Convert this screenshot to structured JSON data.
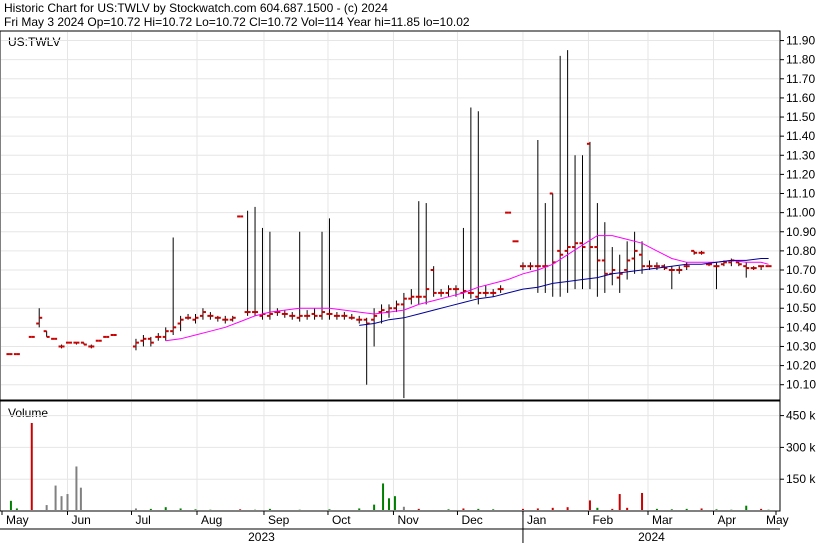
{
  "header": {
    "line1": "Historic Chart for US:TWLV by Stockwatch.com 604.687.1500 - (c) 2024",
    "line2": "Fri May  3 2024  Op=10.72  Hi=10.72  Lo=10.72  Cl=10.72  Vol=114  Year hi=11.85  lo=10.02"
  },
  "chart_data": {
    "type": "ohlc",
    "symbol_label": "US:TWLV",
    "volume_label": "Volume",
    "price_axis_ticks": [
      "11.90",
      "11.80",
      "11.70",
      "11.60",
      "11.50",
      "11.40",
      "11.30",
      "11.20",
      "11.10",
      "11.00",
      "10.90",
      "10.80",
      "10.70",
      "10.60",
      "10.50",
      "10.40",
      "10.30",
      "10.20",
      "10.10"
    ],
    "volume_axis_ticks": [
      "450 k",
      "300 k",
      "150 k"
    ],
    "volume_tick_values": [
      450000,
      300000,
      150000
    ],
    "month_labels": [
      "May",
      "Jun",
      "Jul",
      "Aug",
      "Sep",
      "Oct",
      "Nov",
      "Dec",
      "Jan",
      "Feb",
      "Mar",
      "Apr",
      "May"
    ],
    "year_labels": [
      "2023",
      "2024"
    ],
    "ylim": [
      10.02,
      11.95
    ],
    "price_series": [
      {
        "w": 0.5,
        "o": 10.26,
        "h": 10.26,
        "l": 10.26,
        "c": 10.26
      },
      {
        "w": 1,
        "o": 10.26,
        "h": 10.26,
        "l": 10.26,
        "c": 10.26
      },
      {
        "w": 2,
        "o": 10.35,
        "h": 10.35,
        "l": 10.35,
        "c": 10.35
      },
      {
        "w": 2.5,
        "o": 10.42,
        "h": 10.5,
        "l": 10.4,
        "c": 10.45
      },
      {
        "w": 3,
        "o": 10.38,
        "h": 10.38,
        "l": 10.35,
        "c": 10.35
      },
      {
        "w": 3.5,
        "o": 10.34,
        "h": 10.34,
        "l": 10.34,
        "c": 10.34
      },
      {
        "w": 4,
        "o": 10.3,
        "h": 10.31,
        "l": 10.29,
        "c": 10.3
      },
      {
        "w": 4.5,
        "o": 10.32,
        "h": 10.32,
        "l": 10.32,
        "c": 10.32
      },
      {
        "w": 5,
        "o": 10.32,
        "h": 10.32,
        "l": 10.31,
        "c": 10.32
      },
      {
        "w": 5.5,
        "o": 10.32,
        "h": 10.32,
        "l": 10.31,
        "c": 10.31
      },
      {
        "w": 6,
        "o": 10.3,
        "h": 10.31,
        "l": 10.29,
        "c": 10.3
      },
      {
        "w": 6.5,
        "o": 10.33,
        "h": 10.33,
        "l": 10.33,
        "c": 10.33
      },
      {
        "w": 7,
        "o": 10.35,
        "h": 10.35,
        "l": 10.35,
        "c": 10.35
      },
      {
        "w": 7.5,
        "o": 10.36,
        "h": 10.36,
        "l": 10.36,
        "c": 10.36
      },
      {
        "w": 9,
        "o": 10.3,
        "h": 10.34,
        "l": 10.28,
        "c": 10.32
      },
      {
        "w": 9.5,
        "o": 10.33,
        "h": 10.36,
        "l": 10.3,
        "c": 10.34
      },
      {
        "w": 10,
        "o": 10.34,
        "h": 10.35,
        "l": 10.3,
        "c": 10.32
      },
      {
        "w": 10.5,
        "o": 10.35,
        "h": 10.37,
        "l": 10.33,
        "c": 10.35
      },
      {
        "w": 11,
        "o": 10.35,
        "h": 10.4,
        "l": 10.33,
        "c": 10.38
      },
      {
        "w": 11.5,
        "o": 10.38,
        "h": 10.87,
        "l": 10.36,
        "c": 10.4
      },
      {
        "w": 12,
        "o": 10.42,
        "h": 10.46,
        "l": 10.38,
        "c": 10.44
      },
      {
        "w": 12.5,
        "o": 10.45,
        "h": 10.47,
        "l": 10.44,
        "c": 10.45
      },
      {
        "w": 13,
        "o": 10.44,
        "h": 10.47,
        "l": 10.42,
        "c": 10.45
      },
      {
        "w": 13.5,
        "o": 10.46,
        "h": 10.5,
        "l": 10.44,
        "c": 10.48
      },
      {
        "w": 14,
        "o": 10.46,
        "h": 10.48,
        "l": 10.44,
        "c": 10.46
      },
      {
        "w": 14.5,
        "o": 10.45,
        "h": 10.46,
        "l": 10.43,
        "c": 10.45
      },
      {
        "w": 15,
        "o": 10.44,
        "h": 10.46,
        "l": 10.42,
        "c": 10.44
      },
      {
        "w": 15.5,
        "o": 10.44,
        "h": 10.46,
        "l": 10.43,
        "c": 10.45
      },
      {
        "w": 16,
        "o": 10.98,
        "h": 10.98,
        "l": 10.98,
        "c": 10.98
      },
      {
        "w": 16.5,
        "o": 10.48,
        "h": 11.01,
        "l": 10.46,
        "c": 10.48
      },
      {
        "w": 17,
        "o": 10.48,
        "h": 11.03,
        "l": 10.46,
        "c": 10.48
      },
      {
        "w": 17.5,
        "o": 10.46,
        "h": 10.92,
        "l": 10.44,
        "c": 10.47
      },
      {
        "w": 18,
        "o": 10.46,
        "h": 10.9,
        "l": 10.44,
        "c": 10.47
      },
      {
        "w": 18.5,
        "o": 10.48,
        "h": 10.5,
        "l": 10.46,
        "c": 10.48
      },
      {
        "w": 19,
        "o": 10.47,
        "h": 10.49,
        "l": 10.45,
        "c": 10.47
      },
      {
        "w": 19.5,
        "o": 10.46,
        "h": 10.48,
        "l": 10.44,
        "c": 10.46
      },
      {
        "w": 20,
        "o": 10.45,
        "h": 10.9,
        "l": 10.43,
        "c": 10.46
      },
      {
        "w": 20.5,
        "o": 10.46,
        "h": 10.49,
        "l": 10.44,
        "c": 10.46
      },
      {
        "w": 21,
        "o": 10.47,
        "h": 10.5,
        "l": 10.44,
        "c": 10.46
      },
      {
        "w": 21.5,
        "o": 10.46,
        "h": 10.9,
        "l": 10.44,
        "c": 10.48
      },
      {
        "w": 22,
        "o": 10.47,
        "h": 10.97,
        "l": 10.44,
        "c": 10.47
      },
      {
        "w": 22.5,
        "o": 10.46,
        "h": 10.48,
        "l": 10.44,
        "c": 10.46
      },
      {
        "w": 23,
        "o": 10.46,
        "h": 10.48,
        "l": 10.44,
        "c": 10.46
      },
      {
        "w": 23.5,
        "o": 10.45,
        "h": 10.47,
        "l": 10.44,
        "c": 10.45
      },
      {
        "w": 24,
        "o": 10.44,
        "h": 10.46,
        "l": 10.42,
        "c": 10.44
      },
      {
        "w": 24.5,
        "o": 10.44,
        "h": 10.45,
        "l": 10.1,
        "c": 10.42
      },
      {
        "w": 25,
        "o": 10.44,
        "h": 10.5,
        "l": 10.3,
        "c": 10.46
      },
      {
        "w": 25.5,
        "o": 10.48,
        "h": 10.52,
        "l": 10.42,
        "c": 10.49
      },
      {
        "w": 26,
        "o": 10.48,
        "h": 10.52,
        "l": 10.45,
        "c": 10.5
      },
      {
        "w": 26.5,
        "o": 10.5,
        "h": 10.54,
        "l": 10.48,
        "c": 10.52
      },
      {
        "w": 27,
        "o": 10.52,
        "h": 10.58,
        "l": 10.03,
        "c": 10.55
      },
      {
        "w": 27.5,
        "o": 10.55,
        "h": 10.6,
        "l": 10.52,
        "c": 10.56
      },
      {
        "w": 28,
        "o": 10.56,
        "h": 11.06,
        "l": 10.52,
        "c": 10.56
      },
      {
        "w": 28.5,
        "o": 10.56,
        "h": 11.05,
        "l": 10.52,
        "c": 10.6
      },
      {
        "w": 29,
        "o": 10.7,
        "h": 10.72,
        "l": 10.56,
        "c": 10.58
      },
      {
        "w": 29.5,
        "o": 10.58,
        "h": 10.6,
        "l": 10.56,
        "c": 10.58
      },
      {
        "w": 30,
        "o": 10.58,
        "h": 10.62,
        "l": 10.56,
        "c": 10.6
      },
      {
        "w": 30.5,
        "o": 10.6,
        "h": 10.62,
        "l": 10.56,
        "c": 10.6
      },
      {
        "w": 31,
        "o": 10.58,
        "h": 10.92,
        "l": 10.55,
        "c": 10.59
      },
      {
        "w": 31.5,
        "o": 10.58,
        "h": 11.55,
        "l": 10.55,
        "c": 10.58
      },
      {
        "w": 32,
        "o": 10.56,
        "h": 11.53,
        "l": 10.52,
        "c": 10.58
      },
      {
        "w": 32.5,
        "o": 10.58,
        "h": 10.62,
        "l": 10.56,
        "c": 10.58
      },
      {
        "w": 33,
        "o": 10.58,
        "h": 10.6,
        "l": 10.56,
        "c": 10.58
      },
      {
        "w": 33.5,
        "o": 10.6,
        "h": 10.62,
        "l": 10.58,
        "c": 10.6
      },
      {
        "w": 34,
        "o": 11.0,
        "h": 11.0,
        "l": 11.0,
        "c": 11.0
      },
      {
        "w": 34.5,
        "o": 10.85,
        "h": 10.85,
        "l": 10.85,
        "c": 10.85
      },
      {
        "w": 35,
        "o": 10.72,
        "h": 10.74,
        "l": 10.7,
        "c": 10.72
      },
      {
        "w": 35.5,
        "o": 10.72,
        "h": 10.74,
        "l": 10.7,
        "c": 10.72
      },
      {
        "w": 36,
        "o": 10.72,
        "h": 11.38,
        "l": 10.58,
        "c": 10.72
      },
      {
        "w": 36.5,
        "o": 10.72,
        "h": 11.05,
        "l": 10.58,
        "c": 10.72
      },
      {
        "w": 37,
        "o": 11.1,
        "h": 11.1,
        "l": 10.56,
        "c": 10.74
      },
      {
        "w": 37.5,
        "o": 10.8,
        "h": 11.82,
        "l": 10.56,
        "c": 10.78
      },
      {
        "w": 38,
        "o": 10.8,
        "h": 11.85,
        "l": 10.58,
        "c": 10.82
      },
      {
        "w": 38.5,
        "o": 10.82,
        "h": 11.3,
        "l": 10.6,
        "c": 10.84
      },
      {
        "w": 39,
        "o": 10.84,
        "h": 11.3,
        "l": 10.6,
        "c": 10.82
      },
      {
        "w": 39.5,
        "o": 11.36,
        "h": 11.37,
        "l": 10.6,
        "c": 10.82
      },
      {
        "w": 40,
        "o": 10.82,
        "h": 11.05,
        "l": 10.56,
        "c": 10.75
      },
      {
        "w": 40.5,
        "o": 10.75,
        "h": 10.95,
        "l": 10.58,
        "c": 10.68
      },
      {
        "w": 41,
        "o": 10.68,
        "h": 10.82,
        "l": 10.62,
        "c": 10.7
      },
      {
        "w": 41.5,
        "o": 10.66,
        "h": 10.78,
        "l": 10.58,
        "c": 10.68
      },
      {
        "w": 42,
        "o": 10.7,
        "h": 10.85,
        "l": 10.65,
        "c": 10.75
      },
      {
        "w": 42.5,
        "o": 10.76,
        "h": 10.9,
        "l": 10.68,
        "c": 10.8
      },
      {
        "w": 43,
        "o": 10.78,
        "h": 10.85,
        "l": 10.68,
        "c": 10.72
      },
      {
        "w": 43.5,
        "o": 10.72,
        "h": 10.75,
        "l": 10.7,
        "c": 10.72
      },
      {
        "w": 44,
        "o": 10.72,
        "h": 10.74,
        "l": 10.7,
        "c": 10.72
      },
      {
        "w": 44.5,
        "o": 10.72,
        "h": 10.73,
        "l": 10.7,
        "c": 10.71
      },
      {
        "w": 45,
        "o": 10.7,
        "h": 10.72,
        "l": 10.6,
        "c": 10.7
      },
      {
        "w": 45.5,
        "o": 10.7,
        "h": 10.72,
        "l": 10.68,
        "c": 10.7
      },
      {
        "w": 46,
        "o": 10.72,
        "h": 10.74,
        "l": 10.7,
        "c": 10.72
      },
      {
        "w": 46.5,
        "o": 10.8,
        "h": 10.8,
        "l": 10.78,
        "c": 10.79
      },
      {
        "w": 47,
        "o": 10.79,
        "h": 10.8,
        "l": 10.78,
        "c": 10.79
      },
      {
        "w": 47.5,
        "o": 10.73,
        "h": 10.74,
        "l": 10.72,
        "c": 10.73
      },
      {
        "w": 48,
        "o": 10.72,
        "h": 10.74,
        "l": 10.6,
        "c": 10.72
      },
      {
        "w": 48.5,
        "o": 10.73,
        "h": 10.75,
        "l": 10.72,
        "c": 10.74
      },
      {
        "w": 49,
        "o": 10.74,
        "h": 10.76,
        "l": 10.72,
        "c": 10.75
      },
      {
        "w": 49.5,
        "o": 10.74,
        "h": 10.75,
        "l": 10.72,
        "c": 10.73
      },
      {
        "w": 50,
        "o": 10.72,
        "h": 10.74,
        "l": 10.66,
        "c": 10.71
      },
      {
        "w": 50.5,
        "o": 10.71,
        "h": 10.72,
        "l": 10.7,
        "c": 10.71
      },
      {
        "w": 51,
        "o": 10.72,
        "h": 10.72,
        "l": 10.7,
        "c": 10.72
      },
      {
        "w": 51.5,
        "o": 10.72,
        "h": 10.72,
        "l": 10.72,
        "c": 10.72
      }
    ],
    "ma_pink": [
      [
        11,
        10.33
      ],
      [
        12,
        10.34
      ],
      [
        13,
        10.36
      ],
      [
        14,
        10.38
      ],
      [
        15,
        10.4
      ],
      [
        16,
        10.43
      ],
      [
        17,
        10.46
      ],
      [
        18,
        10.48
      ],
      [
        19,
        10.49
      ],
      [
        20,
        10.5
      ],
      [
        21,
        10.5
      ],
      [
        22,
        10.5
      ],
      [
        23,
        10.49
      ],
      [
        24,
        10.48
      ],
      [
        25,
        10.47
      ],
      [
        26,
        10.48
      ],
      [
        27,
        10.49
      ],
      [
        28,
        10.52
      ],
      [
        29,
        10.54
      ],
      [
        30,
        10.56
      ],
      [
        31,
        10.58
      ],
      [
        32,
        10.61
      ],
      [
        33,
        10.63
      ],
      [
        34,
        10.65
      ],
      [
        35,
        10.68
      ],
      [
        36,
        10.7
      ],
      [
        37,
        10.73
      ],
      [
        38,
        10.78
      ],
      [
        39,
        10.83
      ],
      [
        40,
        10.88
      ],
      [
        41,
        10.88
      ],
      [
        42,
        10.86
      ],
      [
        43,
        10.84
      ],
      [
        44,
        10.8
      ],
      [
        45,
        10.76
      ],
      [
        46,
        10.74
      ],
      [
        47,
        10.74
      ],
      [
        48,
        10.74
      ],
      [
        49,
        10.75
      ],
      [
        50,
        10.74
      ],
      [
        51,
        10.74
      ],
      [
        51.5,
        10.73
      ]
    ],
    "ma_blue": [
      [
        24,
        10.41
      ],
      [
        25,
        10.42
      ],
      [
        26,
        10.44
      ],
      [
        27,
        10.45
      ],
      [
        28,
        10.47
      ],
      [
        29,
        10.49
      ],
      [
        30,
        10.51
      ],
      [
        31,
        10.53
      ],
      [
        32,
        10.55
      ],
      [
        33,
        10.56
      ],
      [
        34,
        10.58
      ],
      [
        35,
        10.6
      ],
      [
        36,
        10.61
      ],
      [
        37,
        10.63
      ],
      [
        38,
        10.64
      ],
      [
        39,
        10.65
      ],
      [
        40,
        10.66
      ],
      [
        41,
        10.68
      ],
      [
        42,
        10.69
      ],
      [
        43,
        10.7
      ],
      [
        44,
        10.71
      ],
      [
        45,
        10.72
      ],
      [
        46,
        10.73
      ],
      [
        47,
        10.73
      ],
      [
        48,
        10.74
      ],
      [
        49,
        10.75
      ],
      [
        50,
        10.75
      ],
      [
        51,
        10.76
      ],
      [
        51.5,
        10.76
      ]
    ],
    "volume_series": [
      {
        "w": 0.6,
        "v": 48000,
        "c": "#008000"
      },
      {
        "w": 1,
        "v": 12000,
        "c": "#008000"
      },
      {
        "w": 2,
        "v": 415000,
        "c": "#cc0000"
      },
      {
        "w": 3,
        "v": 28000,
        "c": "#808080"
      },
      {
        "w": 3.6,
        "v": 120000,
        "c": "#808080"
      },
      {
        "w": 4,
        "v": 70000,
        "c": "#808080"
      },
      {
        "w": 4.4,
        "v": 80000,
        "c": "#808080"
      },
      {
        "w": 5,
        "v": 210000,
        "c": "#808080"
      },
      {
        "w": 5.3,
        "v": 110000,
        "c": "#808080"
      },
      {
        "w": 9,
        "v": 12000,
        "c": "#808080"
      },
      {
        "w": 10,
        "v": 10000,
        "c": "#008000"
      },
      {
        "w": 11,
        "v": 18000,
        "c": "#008000"
      },
      {
        "w": 12,
        "v": 12000,
        "c": "#008000"
      },
      {
        "w": 13,
        "v": 8000,
        "c": "#008000"
      },
      {
        "w": 14,
        "v": 6000,
        "c": "#008000"
      },
      {
        "w": 16,
        "v": 8000,
        "c": "#cc0000"
      },
      {
        "w": 17,
        "v": 6000,
        "c": "#008000"
      },
      {
        "w": 18,
        "v": 10000,
        "c": "#008000"
      },
      {
        "w": 20,
        "v": 6000,
        "c": "#008000"
      },
      {
        "w": 22,
        "v": 8000,
        "c": "#008000"
      },
      {
        "w": 24,
        "v": 12000,
        "c": "#008000"
      },
      {
        "w": 25,
        "v": 30000,
        "c": "#008000"
      },
      {
        "w": 25.6,
        "v": 130000,
        "c": "#008000"
      },
      {
        "w": 26,
        "v": 60000,
        "c": "#008000"
      },
      {
        "w": 26.4,
        "v": 70000,
        "c": "#008000"
      },
      {
        "w": 27,
        "v": 20000,
        "c": "#808080"
      },
      {
        "w": 28,
        "v": 10000,
        "c": "#cc0000"
      },
      {
        "w": 30,
        "v": 8000,
        "c": "#008000"
      },
      {
        "w": 31,
        "v": 12000,
        "c": "#cc0000"
      },
      {
        "w": 32,
        "v": 10000,
        "c": "#008000"
      },
      {
        "w": 33,
        "v": 8000,
        "c": "#008000"
      },
      {
        "w": 35,
        "v": 10000,
        "c": "#cc0000"
      },
      {
        "w": 36,
        "v": 12000,
        "c": "#cc0000"
      },
      {
        "w": 37,
        "v": 15000,
        "c": "#cc0000"
      },
      {
        "w": 38,
        "v": 18000,
        "c": "#cc0000"
      },
      {
        "w": 39.5,
        "v": 50000,
        "c": "#cc0000"
      },
      {
        "w": 40,
        "v": 15000,
        "c": "#008000"
      },
      {
        "w": 41,
        "v": 10000,
        "c": "#cc0000"
      },
      {
        "w": 41.5,
        "v": 80000,
        "c": "#cc0000"
      },
      {
        "w": 42,
        "v": 15000,
        "c": "#cc0000"
      },
      {
        "w": 43,
        "v": 85000,
        "c": "#cc0000"
      },
      {
        "w": 44,
        "v": 10000,
        "c": "#008000"
      },
      {
        "w": 45,
        "v": 8000,
        "c": "#008000"
      },
      {
        "w": 46,
        "v": 10000,
        "c": "#008000"
      },
      {
        "w": 47,
        "v": 12000,
        "c": "#cc0000"
      },
      {
        "w": 48,
        "v": 8000,
        "c": "#008000"
      },
      {
        "w": 49,
        "v": 6000,
        "c": "#008000"
      },
      {
        "w": 50,
        "v": 25000,
        "c": "#008000"
      },
      {
        "w": 51,
        "v": 10000,
        "c": "#cc0000"
      },
      {
        "w": 51.5,
        "v": 6000,
        "c": "#008000"
      }
    ],
    "colors": {
      "bar_up": "#cc0000",
      "bar_wick": "#000000",
      "ma_short": "#ff00ff",
      "ma_long": "#000099",
      "grid": "#e6e6e6"
    }
  }
}
